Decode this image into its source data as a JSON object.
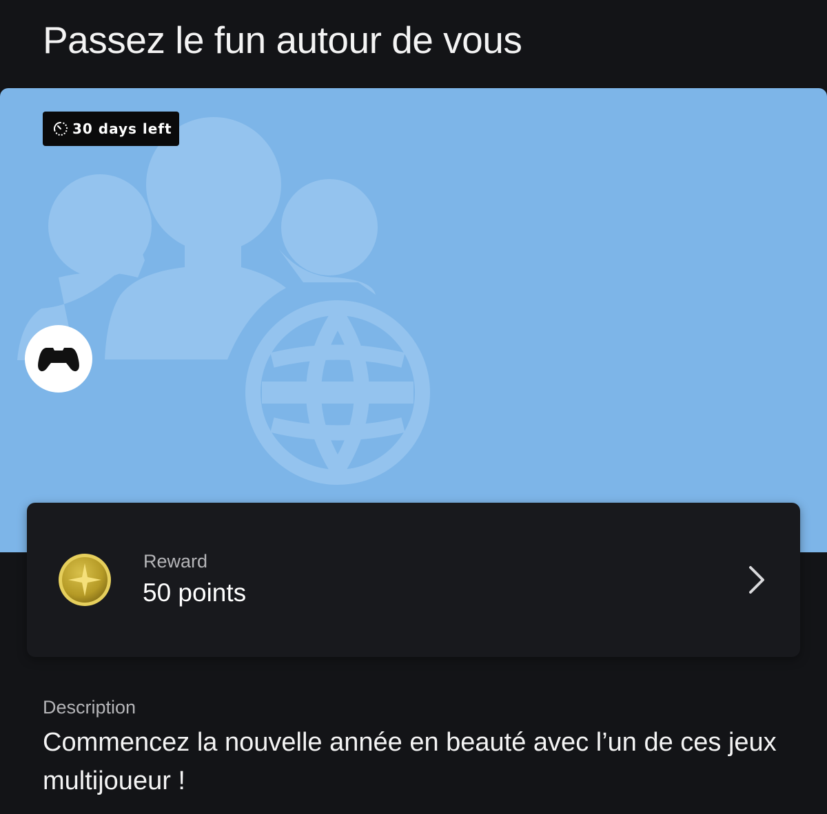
{
  "header": {
    "title": "Passez le fun autour de vous"
  },
  "hero": {
    "background_color": "#7db5e8",
    "art_color": "#94c3ee",
    "art_icons": [
      "people-group-icon",
      "globe-icon"
    ],
    "time_badge": {
      "icon": "timer-icon",
      "text": "30 days left"
    },
    "platform_badge": {
      "icon": "controller-icon"
    }
  },
  "reward": {
    "icon": "coin-star-icon",
    "label": "Reward",
    "value": "50 points",
    "action_icon": "chevron-right-icon"
  },
  "description": {
    "label": "Description",
    "text": "Commencez la nouvelle année en beauté avec l’un de ces jeux multijoueur !"
  }
}
